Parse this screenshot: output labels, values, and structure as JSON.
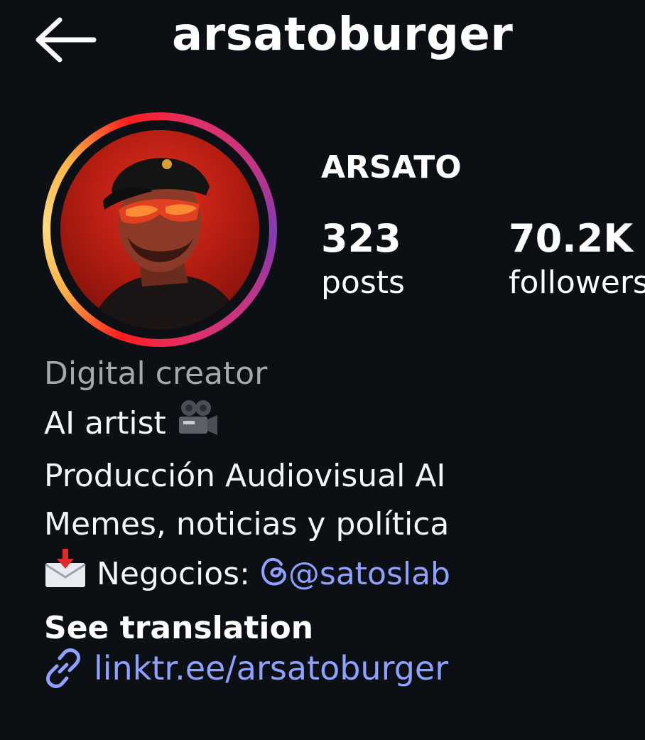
{
  "header": {
    "back_icon": "arrow-left-icon",
    "username": "arsatoburger"
  },
  "profile": {
    "avatar_icon": "profile-photo",
    "display_name": "ARSATO",
    "stats": [
      {
        "value": "323",
        "label": "posts"
      },
      {
        "value": "70.2K",
        "label": "followers"
      }
    ]
  },
  "bio": {
    "category": "Digital creator",
    "line1_text": "AI artist ",
    "line1_emoji": "movie-camera-icon",
    "line2": "Producción Audiovisual AI",
    "line3": "Memes, noticias y política",
    "line4_emoji": "incoming-envelope-icon",
    "line4_prefix": " Negocios: ",
    "line4_mention": "@satoslab",
    "mention_icon": "threads-icon",
    "see_translation": "See translation"
  },
  "link": {
    "icon": "link-icon",
    "text": "linktr.ee/arsatoburger"
  },
  "colors": {
    "background": "#0c1014",
    "text": "#f5f5f5",
    "muted": "#a8a8a8",
    "link": "#8ea1ff"
  }
}
